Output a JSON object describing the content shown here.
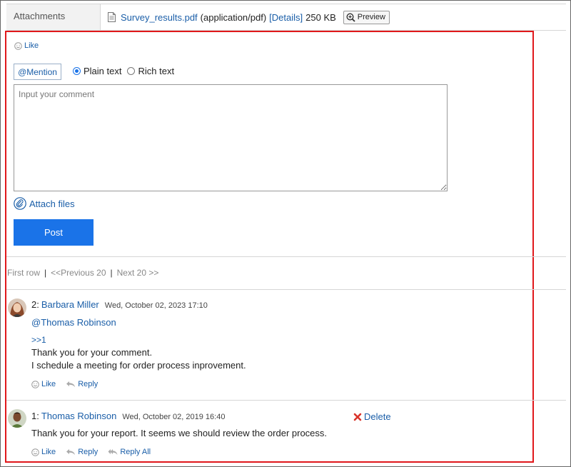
{
  "attachments": {
    "label": "Attachments",
    "file_name": "Survey_results.pdf",
    "file_type": "(application/pdf)",
    "details_label": "[Details]",
    "file_size": "250 KB",
    "preview_label": "Preview"
  },
  "editor": {
    "like_label": "Like",
    "mention_label": "@Mention",
    "plain_text_label": "Plain text",
    "rich_text_label": "Rich text",
    "selected_format": "plain",
    "comment_placeholder": "Input your comment",
    "comment_value": "",
    "attach_files_label": "Attach files",
    "post_label": "Post"
  },
  "pager": {
    "first_row": "First row",
    "separator": "|",
    "previous": "<<Previous 20",
    "next": "Next 20 >>"
  },
  "comments": [
    {
      "number": "2:",
      "author": "Barbara Miller",
      "date": "Wed, October 02, 2023 17:10",
      "mention": "@Thomas Robinson",
      "quote_ref": ">>1",
      "lines": [
        "Thank you for your comment.",
        "I schedule a meeting for order process inprovement."
      ],
      "actions": [
        "Like",
        "Reply"
      ]
    },
    {
      "number": "1:",
      "author": "Thomas Robinson",
      "date": "Wed, October 02, 2019 16:40",
      "delete_label": "Delete",
      "lines": [
        "Thank you for your report. It seems we should review the order process."
      ],
      "actions": [
        "Like",
        "Reply",
        "Reply All"
      ]
    }
  ],
  "colors": {
    "link": "#1a5ea8",
    "primary_button": "#1a73e8",
    "highlight_border": "#e0181b",
    "delete_icon": "#d9342b"
  }
}
